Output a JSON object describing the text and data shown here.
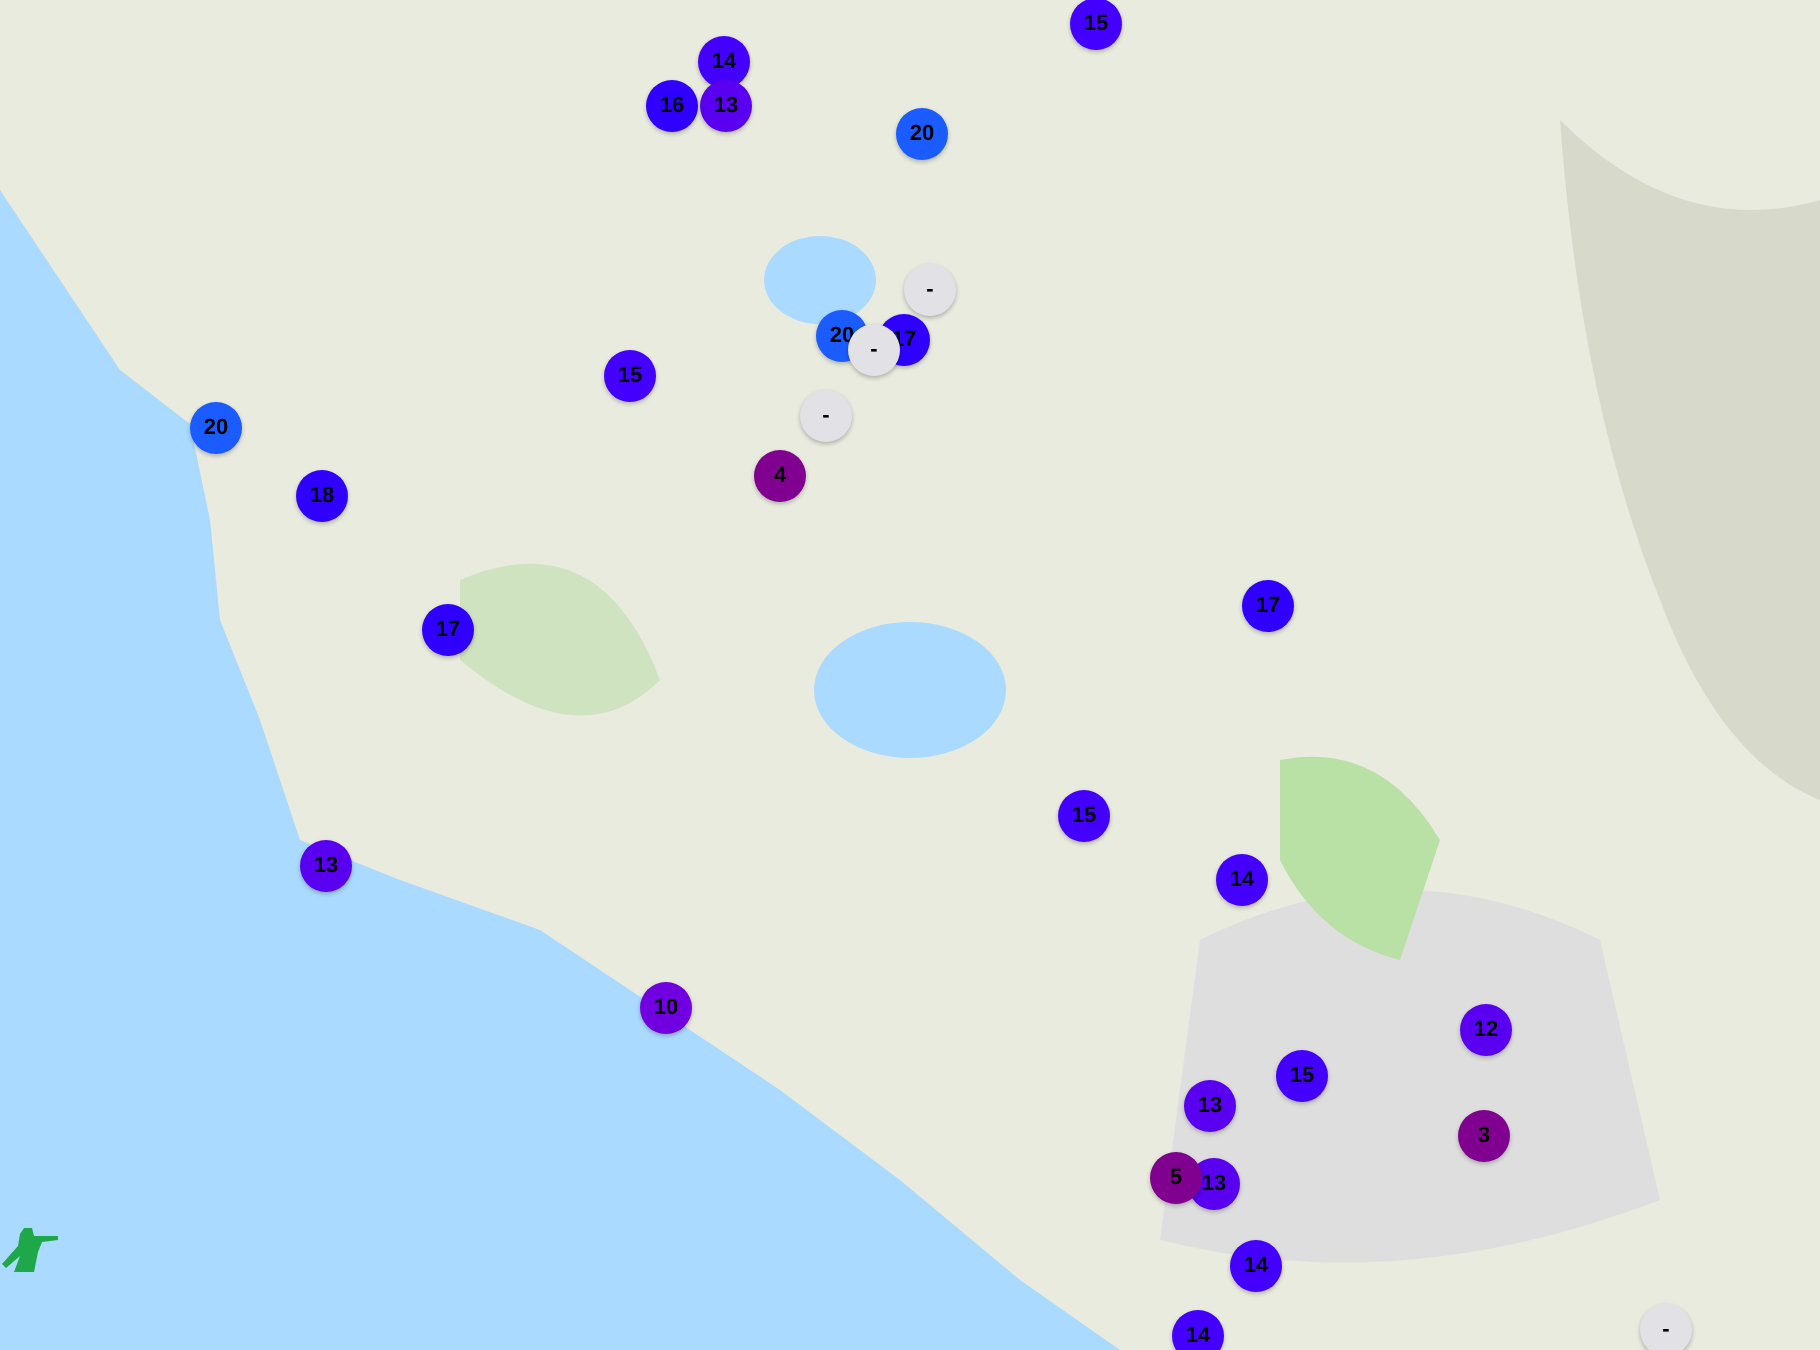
{
  "map": {
    "markers": [
      {
        "label": "15",
        "color": "#4400ff"
      },
      {
        "label": "14",
        "color": "#4400ff"
      },
      {
        "label": "16",
        "color": "#2f00ff"
      },
      {
        "label": "13",
        "color": "#5a00f0"
      },
      {
        "label": "20",
        "color": "#1a5cff"
      },
      {
        "label": "-",
        "color": "#e2e2e6"
      },
      {
        "label": "20",
        "color": "#1a5cff"
      },
      {
        "label": "17",
        "color": "#2f00ff"
      },
      {
        "label": "-",
        "color": "#e2e2e6"
      },
      {
        "label": "-",
        "color": "#e2e2e6"
      },
      {
        "label": "15",
        "color": "#4400ff"
      },
      {
        "label": "4",
        "color": "#800090"
      },
      {
        "label": "20",
        "color": "#1a5cff"
      },
      {
        "label": "18",
        "color": "#2f00ff"
      },
      {
        "label": "17",
        "color": "#2f00ff"
      },
      {
        "label": "17",
        "color": "#2f00ff"
      },
      {
        "label": "15",
        "color": "#4400ff"
      },
      {
        "label": "14",
        "color": "#4400ff"
      },
      {
        "label": "13",
        "color": "#5a00f0"
      },
      {
        "label": "10",
        "color": "#7000e0"
      },
      {
        "label": "12",
        "color": "#5a00f0"
      },
      {
        "label": "15",
        "color": "#4400ff"
      },
      {
        "label": "13",
        "color": "#5a00f0"
      },
      {
        "label": "3",
        "color": "#800090"
      },
      {
        "label": "13",
        "color": "#5a00f0"
      },
      {
        "label": "5",
        "color": "#800090"
      },
      {
        "label": "14",
        "color": "#4400ff"
      },
      {
        "label": "14",
        "color": "#4400ff"
      },
      {
        "label": "-",
        "color": "#e2e2e6"
      }
    ]
  }
}
